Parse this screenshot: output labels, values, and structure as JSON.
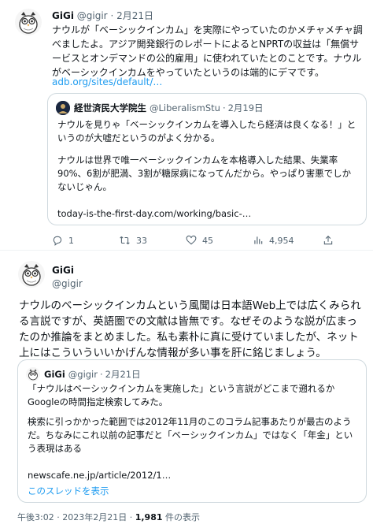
{
  "tweet1": {
    "display_name": "GiGi",
    "handle": "@gigir",
    "separator": "·",
    "date": "2月21日",
    "body": "ナウルが「ベーシックインカム」を実際にやっていたのかメチャメチャ調べましたよ。アジア開発銀行のレポートによるとNPRTの収益は「無償サービスとオンデマンドの公的雇用」に使われていたとのことです。ナウルがベーシックインカムをやっていたというのは端的にデマです。",
    "link": "adb.org/sites/default/…",
    "quote": {
      "display_name": "経世済民大学院生",
      "handle": "@LiberalismStu",
      "separator": "·",
      "date": "2月19日",
      "text1": "ナウルを見りゃ「ベーシックインカムを導入したら経済は良くなる！」というのが大嘘だというのがよく分かる。",
      "text2": "ナウルは世界で唯一ベーシックインカムを本格導入した結果、失業率90%、6割が肥満、3割が糖尿病になってんだから。やっぱり害悪でしかないじゃん。",
      "link": "today-is-the-first-day.com/working/basic-…"
    },
    "actions": {
      "reply_count": "1",
      "retweet_count": "33",
      "like_count": "45",
      "views_count": "4,954"
    }
  },
  "tweet2": {
    "display_name": "GiGi",
    "handle": "@gigir",
    "body": "ナウルのベーシックインカムという風聞は日本語Web上では広くみられる言説ですが、英語圏での文献は皆無です。なぜそのような説が広まったのか推論をまとめました。私も素朴に真に受けていましたが、ネット上にはこういういいかげんな情報が多い事を肝に銘じましょう。",
    "quote": {
      "display_name": "GiGi",
      "handle": "@gigir",
      "separator": "·",
      "date": "2月21日",
      "text1": "「ナウルはベーシックインカムを実施した」という言説がどこまで遡れるかGoogleの時間指定検索してみた。",
      "text2": "検索に引っかかった範囲では2012年11月のこのコラム記事あたりが最古のようだ。ちなみにこれ以前の記事だと「ベーシックインカム」ではなく「年金」という表現はある",
      "link": "newscafe.ne.jp/article/2012/1…",
      "show_thread": "このスレッドを表示"
    },
    "footer": {
      "time": "午後3:02",
      "separator": "·",
      "date": "2023年2月21日",
      "separator2": "·",
      "views": "1,981",
      "views_label": "件の表示"
    }
  },
  "colors": {
    "link": "#1d9bf0",
    "muted": "#536471",
    "border": "#cfd9de",
    "text": "#0f1419"
  },
  "icons": {
    "avatar": "owl-avatar-icon",
    "quote_avatar": "dark-avatar-icon",
    "reply": "reply-icon",
    "retweet": "retweet-icon",
    "like": "heart-icon",
    "views": "views-bar-chart-icon",
    "share": "share-icon"
  }
}
